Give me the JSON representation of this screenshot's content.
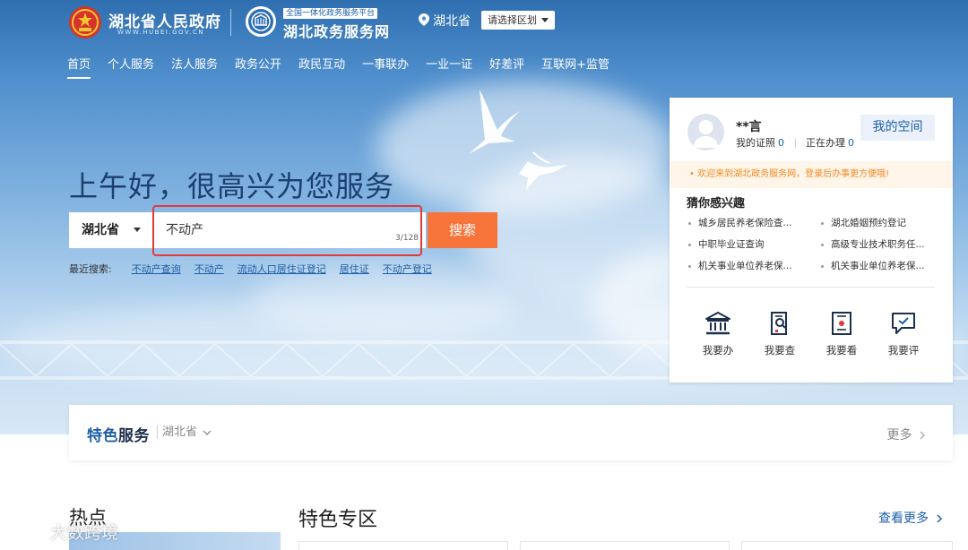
{
  "header": {
    "gov_title": "湖北省人民政府",
    "gov_subtitle": "WWW.HUBEI.GOV.CN",
    "service_badge": "全国一体化政务服务平台",
    "service_title": "湖北政务服务网",
    "location": "湖北省",
    "region_select": "请选择区划"
  },
  "nav": {
    "items": [
      "首页",
      "个人服务",
      "法人服务",
      "政务公开",
      "政民互动",
      "一事联办",
      "一业一证",
      "好差评",
      "互联网+监管"
    ]
  },
  "hero": {
    "greeting": "上午好，很高兴为您服务",
    "search_scope": "湖北省",
    "search_value": "不动产",
    "search_count": "3/128",
    "search_button": "搜索",
    "recent_label": "最近搜索:",
    "recent": [
      "不动产查询",
      "不动产",
      "流动人口居住证登记",
      "居住证",
      "不动产登记"
    ]
  },
  "user_card": {
    "name": "**言",
    "licenses_label": "我的证照",
    "licenses_count": "0",
    "processing_label": "正在办理",
    "processing_count": "0",
    "my_space": "我的空间",
    "notice": "• 欢迎来到湖北政务服务网，登录后办事更方便哦!",
    "interest_title": "猜你感兴趣",
    "interests": [
      "城乡居民养老保险查...",
      "湖北婚姻预约登记",
      "中职毕业证查询",
      "高级专业技术职务任...",
      "机关事业单位养老保...",
      "机关事业单位养老保..."
    ],
    "quick": [
      {
        "label": "我要办",
        "icon": "bank-icon"
      },
      {
        "label": "我要查",
        "icon": "search-doc-icon"
      },
      {
        "label": "我要看",
        "icon": "monitor-icon"
      },
      {
        "label": "我要评",
        "icon": "comment-check-icon"
      }
    ]
  },
  "feature": {
    "title_part1": "特色",
    "title_part2": "服务",
    "region": "湖北省",
    "more": "更多"
  },
  "bottom": {
    "hot_title": "热点",
    "special_title": "特色专区",
    "view_more": "查看更多"
  },
  "watermark": "大数跨境",
  "colors": {
    "accent_blue": "#1f5fa6",
    "search_orange": "#f7743a",
    "highlight_red": "#e23a3a",
    "notice_orange": "#f08a24"
  }
}
